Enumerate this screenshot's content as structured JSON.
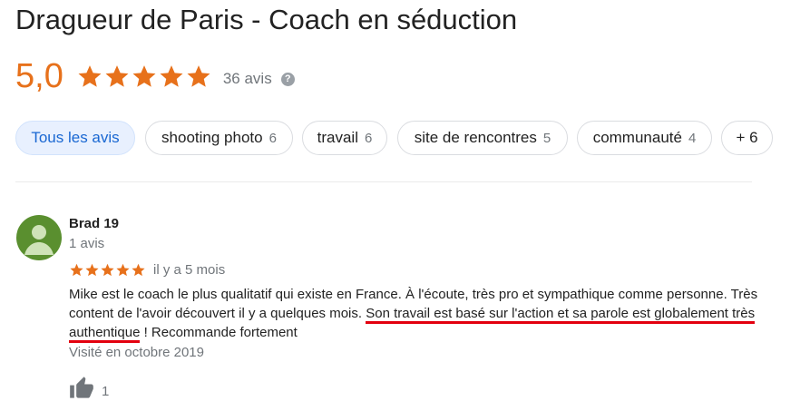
{
  "business": {
    "title": "Dragueur de Paris - Coach en séduction"
  },
  "rating": {
    "value": "5,0",
    "stars": 5,
    "review_count_label": "36 avis",
    "star_color": "#e7711b"
  },
  "chips": [
    {
      "label": "Tous les avis",
      "count": ""
    },
    {
      "label": "shooting photo",
      "count": "6"
    },
    {
      "label": "travail",
      "count": "6"
    },
    {
      "label": "site de rencontres",
      "count": "5"
    },
    {
      "label": "communauté",
      "count": "4"
    },
    {
      "label": "+ 6",
      "count": ""
    }
  ],
  "review": {
    "author": "Brad 19",
    "author_reviews": "1 avis",
    "stars": 5,
    "date": "il y a 5 mois",
    "text_part1": "Mike est le coach le plus qualitatif qui existe en France. À l'écoute, très pro et sympathique comme personne. Très content de l'avoir découvert il y a quelques mois. ",
    "text_highlight": "Son travail est basé sur l'action et sa parole est globalement très authentique",
    "text_part2": " ! Recommande fortement",
    "visited": "Visité en octobre 2019",
    "likes": "1",
    "highlight_color": "#e3000f"
  }
}
